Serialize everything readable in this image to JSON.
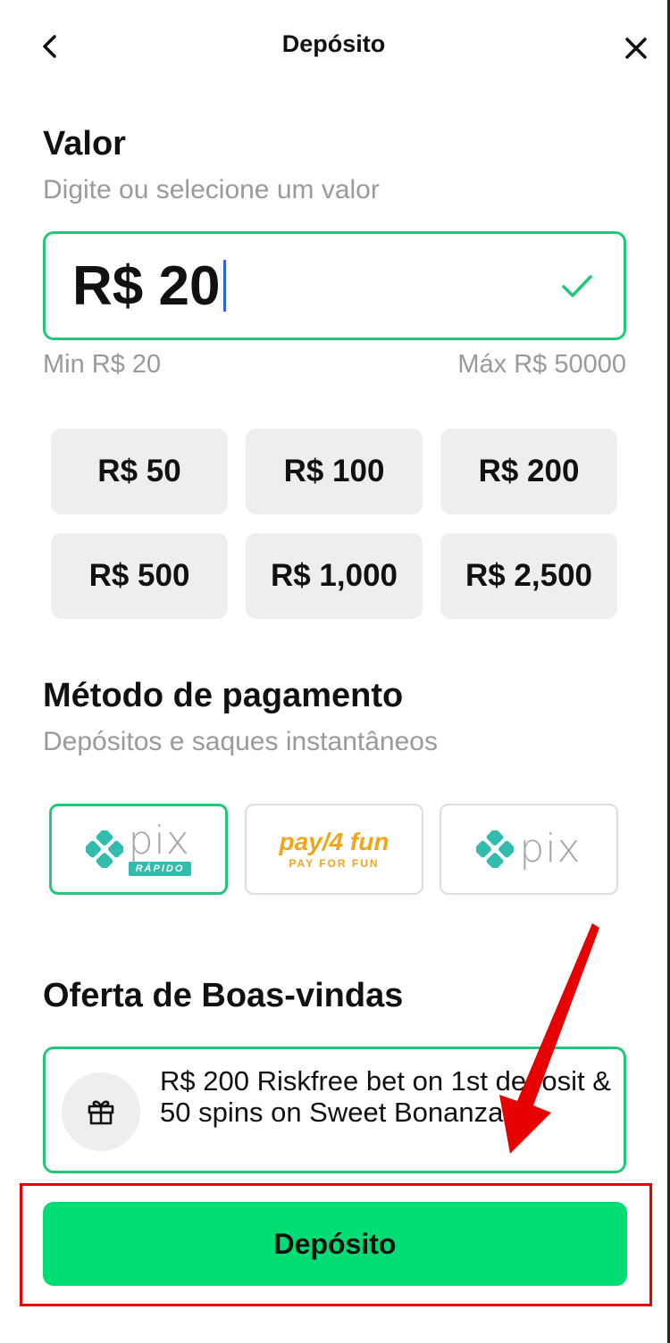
{
  "header": {
    "title": "Depósito"
  },
  "amount_section": {
    "title": "Valor",
    "subtitle": "Digite ou selecione um valor",
    "input_value": "R$ 20",
    "min_label": "Min R$ 20",
    "max_label": "Máx R$ 50000"
  },
  "presets": [
    "R$ 50",
    "R$ 100",
    "R$ 200",
    "R$ 500",
    "R$ 1,000",
    "R$ 2,500"
  ],
  "payment_section": {
    "title": "Método de pagamento",
    "subtitle": "Depósitos e saques instantâneos",
    "methods": [
      {
        "name": "pix",
        "badge": "RÁPIDO",
        "selected": true
      },
      {
        "name": "pay4fun",
        "brand_top": "pay/4 fun",
        "brand_bottom": "PAY FOR FUN",
        "selected": false
      },
      {
        "name": "pix",
        "selected": false
      }
    ]
  },
  "offer_section": {
    "title": "Oferta de Boas-vindas",
    "text": "R$ 200 Riskfree bet on 1st deposit & 50 spins on Sweet Bonanza",
    "icon": "gift-icon"
  },
  "deposit_button": {
    "label": "Depósito"
  },
  "colors": {
    "accent_green": "#00dd74",
    "border_green": "#22c77a",
    "pix_teal": "#32bcad",
    "pay4fun_orange": "#f2a516",
    "annotation_red": "#e60000"
  }
}
